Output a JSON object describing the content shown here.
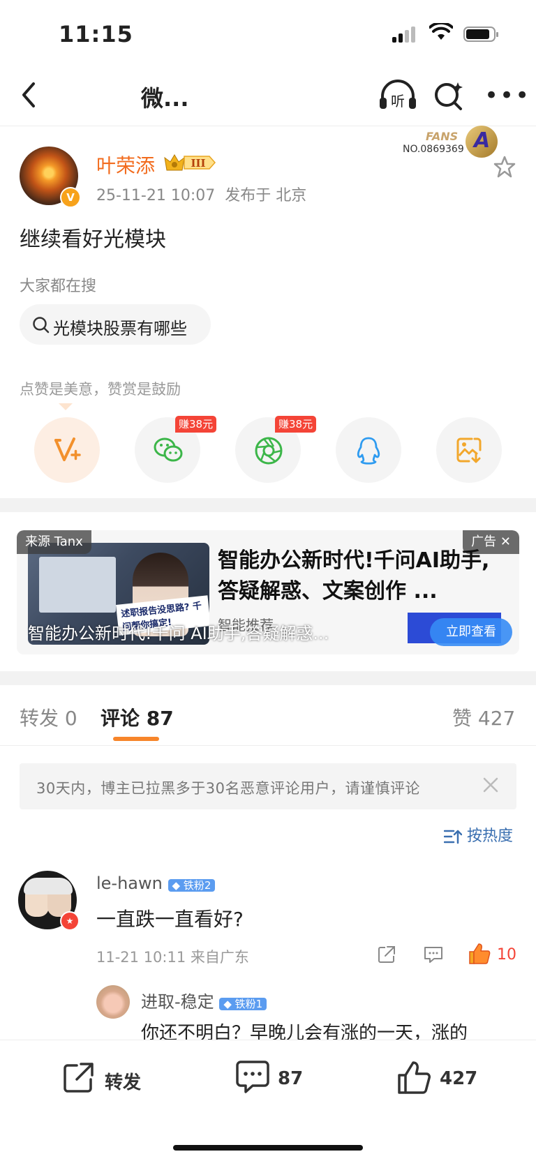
{
  "status_bar": {
    "time": "11:15"
  },
  "nav": {
    "title": "微...",
    "listen_label": "听"
  },
  "fans_badge": {
    "brand": "FANS",
    "number": "NO.0869369"
  },
  "post": {
    "author": "叶荣添",
    "level": "III",
    "time": "25-11-21 10:07",
    "location": "发布于 北京",
    "text": "继续看好光模块"
  },
  "searching": {
    "label": "大家都在搜",
    "query": "光模块股票有哪些"
  },
  "share": {
    "hint": "点赞是美意，赞赏是鼓励",
    "earn_wechat": "赚38元",
    "earn_moments": "赚38元"
  },
  "ad": {
    "source": "来源 Tanx",
    "tag": "广告",
    "headline": "智能办公新时代!千问AI助手,答疑解惑、文案创作 ...",
    "sub": "智能推荐",
    "button": "立即查看",
    "overlay": "智能办公新时代!千问 AI助手,答疑解惑...",
    "image_slogan": "述职报告没思路? 千问帮你搞定!"
  },
  "tabs": {
    "repost": "转发 0",
    "comment": "评论 87",
    "like": "赞 427"
  },
  "notice": {
    "text": "30天内，博主已拉黑多于30名恶意评论用户，请谨慎评论"
  },
  "sort": {
    "label": "按热度"
  },
  "comment": {
    "user": "le-hawn",
    "badge": "铁粉2",
    "text": "一直跌一直看好?",
    "meta": "11-21 10:11 来自广东",
    "likes": "10"
  },
  "reply": {
    "user": "进取-稳定",
    "badge": "铁粉1",
    "text": "你还不明白？早晚儿会有涨的一天，涨的"
  },
  "bottom_bar": {
    "repost": "转发",
    "comment_count": "87",
    "like_count": "427"
  },
  "colors": {
    "accent_orange": "#f26b1d",
    "tab_underline": "#f7852a",
    "earn_red": "#f44437",
    "sort_blue": "#3a6fb0",
    "fan_badge_blue": "#5b9cf0"
  }
}
